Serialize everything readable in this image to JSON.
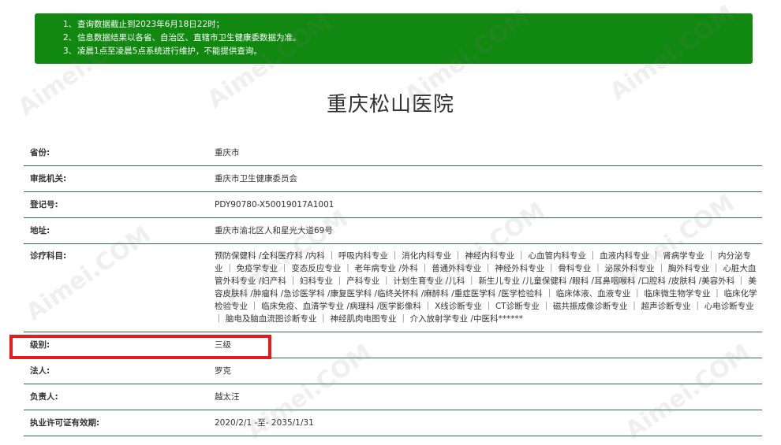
{
  "notice": {
    "items": [
      {
        "num": "1、",
        "text": "查询数据截止到2023年6月18日22时；"
      },
      {
        "num": "2、",
        "text": "信息数据结果以各省、自治区、直辖市卫生健康委数据为准。"
      },
      {
        "num": "3、",
        "text": "凌晨1点至凌晨5点系统进行维护，不能提供查询。"
      }
    ]
  },
  "hospital": {
    "name": "重庆松山医院"
  },
  "fields": {
    "province": {
      "label": "省份:",
      "value": "重庆市"
    },
    "authority": {
      "label": "审批机关:",
      "value": "重庆市卫生健康委员会"
    },
    "reg_no": {
      "label": "登记号:",
      "value": "PDY90780-X50019017A1001"
    },
    "address": {
      "label": "地址:",
      "value": "重庆市渝北区人和星光大道69号"
    },
    "departments": {
      "label": "诊疗科目:",
      "value": "预防保健科 /全科医疗科 /内科 ｜ 呼吸内科专业 ｜ 消化内科专业 ｜ 神经内科专业 ｜ 心血管内科专业 ｜ 血液内科专业 ｜ 肾病学专业 ｜ 内分泌专业 ｜ 免疫学专业 ｜ 变态反应专业 ｜ 老年病专业 /外科 ｜ 普通外科专业 ｜ 神经外科专业 ｜ 骨科专业 ｜ 泌尿外科专业 ｜ 胸外科专业 ｜ 心脏大血管外科专业 /妇产科 ｜ 妇科专业 ｜ 产科专业 ｜ 计划生育专业 /儿科 ｜ 新生儿专业 /儿童保健科 /眼科 /耳鼻咽喉科 /口腔科 /皮肤科 /美容外科 ｜ 美容皮肤科 /肿瘤科 /急诊医学科 /康复医学科 /临终关怀科 /麻醉科 /重症医学科 /医学检验科 ｜ 临床体液、血液专业 ｜ 临床微生物学专业 ｜ 临床化学检验专业 ｜ 临床免疫、血清学专业 /病理科 /医学影像科 ｜ X线诊断专业 ｜ CT诊断专业 ｜ 磁共振成像诊断专业 ｜ 超声诊断专业 ｜ 心电诊断专业 ｜ 脑电及脑血流图诊断专业 ｜ 神经肌肉电图专业 ｜ 介入放射学专业 /中医科******"
    },
    "level": {
      "label": "级别:",
      "value": "三级"
    },
    "legal_person": {
      "label": "法人:",
      "value": "罗克"
    },
    "principal": {
      "label": "负责人:",
      "value": "越太汪"
    },
    "license_validity": {
      "label": "执业许可证有效期:",
      "value": "2020/2/1 -至- 2035/1/31"
    }
  },
  "watermark": {
    "text": "Aimei.COM"
  },
  "colors": {
    "notice_bg": "#118911",
    "row_border": "#2f6b4f",
    "highlight": "#e41c1c"
  }
}
